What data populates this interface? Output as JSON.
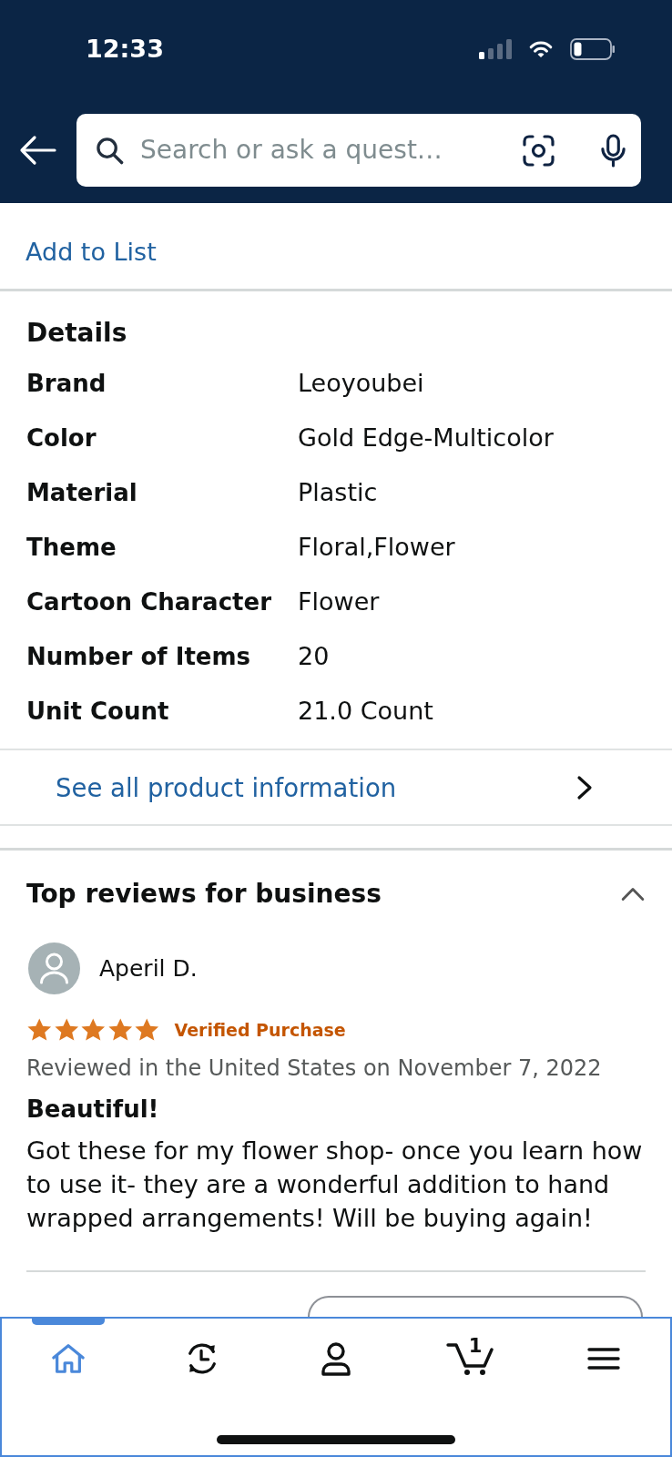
{
  "status_bar": {
    "time": "12:33"
  },
  "search": {
    "placeholder": "Search or ask a quest…"
  },
  "add_to_list": {
    "label": "Add to List"
  },
  "details": {
    "title": "Details",
    "rows": [
      {
        "label": "Brand",
        "value": "Leoyoubei"
      },
      {
        "label": "Color",
        "value": "Gold Edge-Multicolor"
      },
      {
        "label": "Material",
        "value": "Plastic"
      },
      {
        "label": "Theme",
        "value": "Floral,Flower"
      },
      {
        "label": "Cartoon Character",
        "value": "Flower"
      },
      {
        "label": "Number of Items",
        "value": "20"
      },
      {
        "label": "Unit Count",
        "value": "21.0 Count"
      }
    ]
  },
  "product_info_link": {
    "label": "See all product information"
  },
  "reviews": {
    "title": "Top reviews for business",
    "expanded": true,
    "items": [
      {
        "author": "Aperil D.",
        "stars": 5,
        "badge": "Verified Purchase",
        "meta": "Reviewed in the United States on November 7, 2022",
        "headline": "Beautiful!",
        "body": "Got these for my flower shop- once you learn how to use it- they are a wonderful addition to hand wrapped arrangements! Will be buying again!"
      }
    ]
  },
  "tab_bar": {
    "tabs": [
      {
        "kind": "home",
        "selected": true
      },
      {
        "kind": "history",
        "selected": false
      },
      {
        "kind": "account",
        "selected": false
      },
      {
        "kind": "cart",
        "selected": false,
        "count": "1"
      },
      {
        "kind": "menu",
        "selected": false
      }
    ]
  }
}
